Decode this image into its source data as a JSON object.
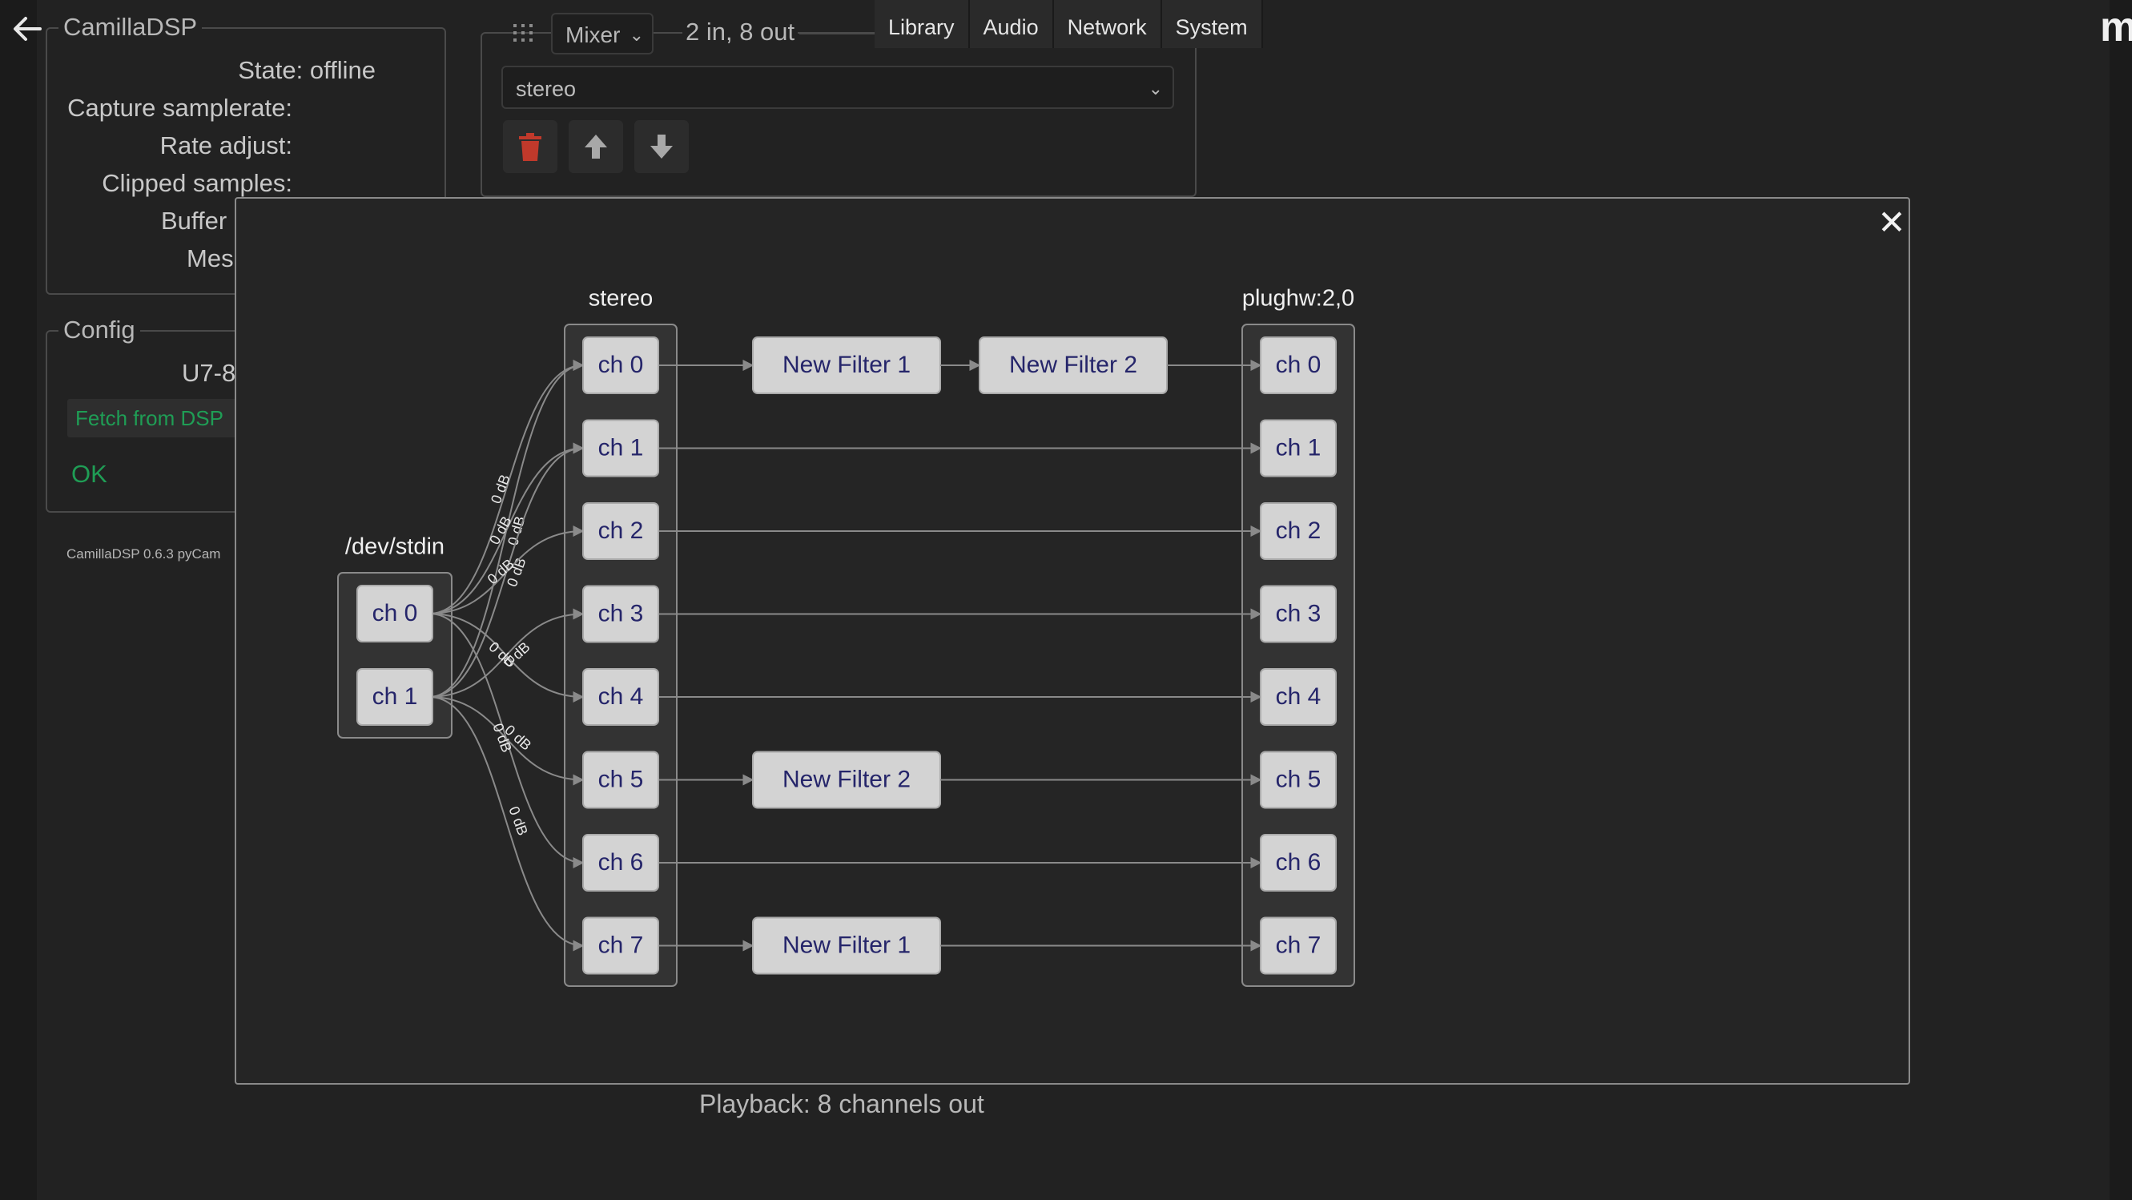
{
  "app": {
    "title": "CamillaDSP",
    "brand_letter": "m"
  },
  "status": {
    "legend": "CamillaDSP",
    "state_label": "State: offline",
    "capture_samplerate_label": "Capture samplerate:",
    "rate_adjust_label": "Rate adjust:",
    "clipped_samples_label": "Clipped samples:",
    "buffer_label": "Buffer",
    "message_label": "Mes"
  },
  "config": {
    "legend": "Config",
    "name": "U7-8",
    "fetch_button": "Fetch from DSP",
    "status_text": "OK"
  },
  "versions": {
    "text": "CamillaDSP 0.6.3     pyCam"
  },
  "pipeline_step": {
    "type_select": "Mixer",
    "io": "2 in, 8 out",
    "name_select": "stereo",
    "delete_icon": "trash-icon",
    "up_icon": "arrow-up-icon",
    "down_icon": "arrow-down-icon"
  },
  "nav": {
    "tabs": [
      "Library",
      "Audio",
      "Network",
      "System"
    ]
  },
  "playback": {
    "text": "Playback: 8 channels out"
  },
  "modal": {
    "close_icon": "close-icon",
    "close_glyph": "✕"
  },
  "graph": {
    "capture": {
      "title": "/dev/stdin",
      "channels": [
        "ch 0",
        "ch 1"
      ]
    },
    "mixer": {
      "title": "stereo",
      "channels": [
        "ch 0",
        "ch 1",
        "ch 2",
        "ch 3",
        "ch 4",
        "ch 5",
        "ch 6",
        "ch 7"
      ]
    },
    "playback": {
      "title": "plughw:2,0",
      "channels": [
        "ch 0",
        "ch 1",
        "ch 2",
        "ch 3",
        "ch 4",
        "ch 5",
        "ch 6",
        "ch 7"
      ]
    },
    "filters": [
      {
        "channel": 0,
        "names": [
          "New Filter 1",
          "New Filter 2"
        ]
      },
      {
        "channel": 5,
        "names": [
          "New Filter 2"
        ]
      },
      {
        "channel": 7,
        "names": [
          "New Filter 1"
        ]
      }
    ],
    "mixer_links": [
      {
        "from": 0,
        "to": 0,
        "gain": "0 dB"
      },
      {
        "from": 1,
        "to": 0,
        "gain": "0 dB"
      },
      {
        "from": 0,
        "to": 1,
        "gain": "0 dB"
      },
      {
        "from": 1,
        "to": 1,
        "gain": "0 dB"
      },
      {
        "from": 0,
        "to": 2,
        "gain": "0 dB"
      },
      {
        "from": 1,
        "to": 3,
        "gain": "0 dB"
      },
      {
        "from": 0,
        "to": 4,
        "gain": "0 dB"
      },
      {
        "from": 1,
        "to": 5,
        "gain": "0 dB"
      },
      {
        "from": 0,
        "to": 6,
        "gain": "0 dB"
      },
      {
        "from": 1,
        "to": 7,
        "gain": "0 dB"
      }
    ]
  }
}
